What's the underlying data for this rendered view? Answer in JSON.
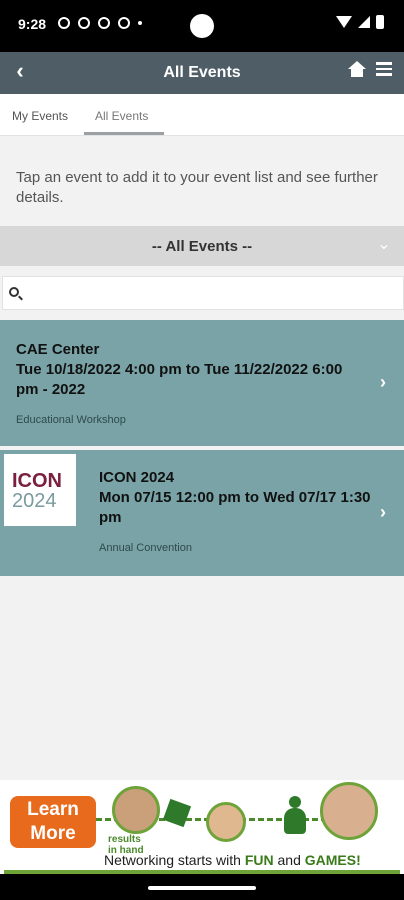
{
  "status_bar": {
    "time": "9:28",
    "icons_left": [
      "notification-icon",
      "shield-icon",
      "shield-check-icon",
      "fan-icon",
      "dot-icon"
    ],
    "icons_right": [
      "wifi-icon",
      "signal-icon",
      "battery-icon"
    ]
  },
  "header": {
    "title": "All Events",
    "back_icon": "‹",
    "home_icon": "home-icon",
    "menu_icon": "menu-icon",
    "color": "#4f5e66"
  },
  "tabs": [
    {
      "label": "My Events",
      "active": false
    },
    {
      "label": "All Events",
      "active": true
    }
  ],
  "intro_text": "Tap an event to add it to your event list and see further details.",
  "filter": {
    "selected": "-- All Events --"
  },
  "search": {
    "value": "",
    "placeholder": ""
  },
  "events": [
    {
      "title": "CAE Center",
      "dates": "Tue 10/18/2022 4:00 pm to Tue 11/22/2022 6:00 pm - 2022",
      "type": "Educational Workshop",
      "logo": null
    },
    {
      "title": "ICON 2024",
      "dates": "Mon 07/15 12:00 pm to Wed 07/17 1:30 pm",
      "type": "Annual Convention",
      "logo": {
        "line1": "ICON",
        "line2": "2024"
      }
    }
  ],
  "colors": {
    "event_card": "#79a3a6",
    "background": "#f2f2f2",
    "filter_bar": "#d7d7d7"
  },
  "banner": {
    "button_line1": "Learn",
    "button_line2": "More",
    "brand_top": "results",
    "brand_bottom": "in hand",
    "tagline_prefix": "Networking starts with ",
    "tagline_fun": "FUN",
    "tagline_and": " and ",
    "tagline_games": "GAMES!"
  }
}
